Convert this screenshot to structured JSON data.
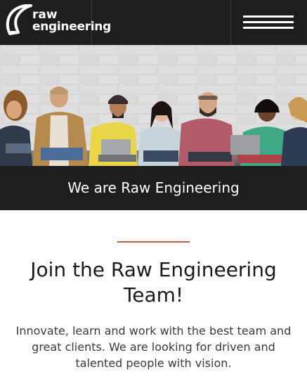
{
  "header": {
    "logo": {
      "line1": "raw",
      "line2": "engineering",
      "trademark": "™",
      "icon": "raw-engineering-logo-mark"
    },
    "menu": {
      "icon": "hamburger-menu-icon"
    }
  },
  "hero": {
    "image": "team-photo"
  },
  "banner": {
    "text": "We are Raw Engineering"
  },
  "section": {
    "title": "Join the Raw Engineering Team!",
    "body": "Innovate, learn and work with the best team and great clients. We are looking for driven and talented people with vision."
  },
  "colors": {
    "header_bg": "#1e1e1e",
    "accent": "#c9574d",
    "title_text": "#1a1a1a",
    "body_text": "#3a3a3a"
  }
}
